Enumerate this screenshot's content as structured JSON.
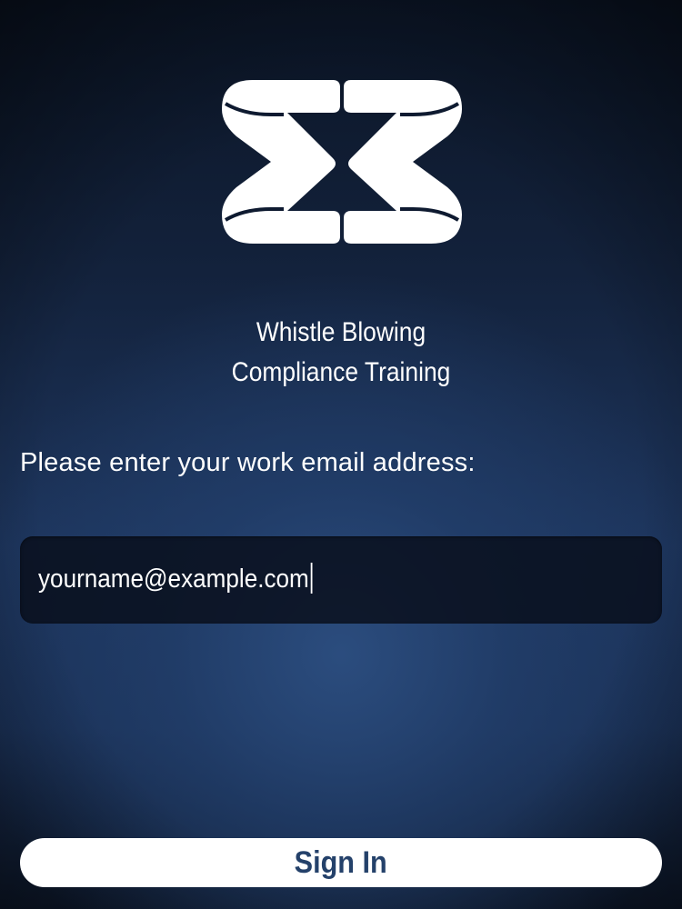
{
  "app": {
    "title_line1": "Whistle Blowing",
    "title_line2": "Compliance Training",
    "logo_icon": "company-logo-icon"
  },
  "login": {
    "prompt": "Please enter your work email address:",
    "email_value": "yourname@example.com",
    "sign_in_label": "Sign In"
  },
  "colors": {
    "background_dark": "#0b1526",
    "background_accent": "#2c4e80",
    "field_background": "#080e1a",
    "button_background": "#ffffff",
    "button_text": "#24416a"
  }
}
